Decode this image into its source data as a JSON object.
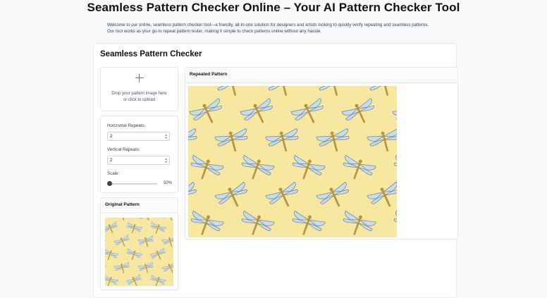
{
  "page": {
    "title": "Seamless Pattern Checker Online – Your AI Pattern Checker Tool",
    "intro_line1": "Welcome to our online, seamless pattern checker tool—a friendly, all-in-one solution for designers and artists looking to quickly verify repeating and seamless patterns.",
    "intro_line2": "Our tool works as your go-to repeat pattern tester, making it simple to check patterns online without any hassle."
  },
  "tool": {
    "title": "Seamless Pattern Checker",
    "upload": {
      "line1": "Drop your pattern image here",
      "line2": "or click to upload",
      "icon": "plus-icon"
    },
    "settings": {
      "horizontal_label": "Horizontal Repeats:",
      "horizontal_value": "2",
      "vertical_label": "Vertical Repeats:",
      "vertical_value": "2",
      "scale_label": "Scale:",
      "scale_value": "50%",
      "scale_fraction": 0.0
    },
    "original_title": "Original Pattern",
    "repeated_title": "Repeated Pattern",
    "pattern_colors": {
      "background": "#f7e7a1",
      "wing": "#c9dcea",
      "wing_edge": "#6f8aa3",
      "body": "#b8923a"
    }
  }
}
